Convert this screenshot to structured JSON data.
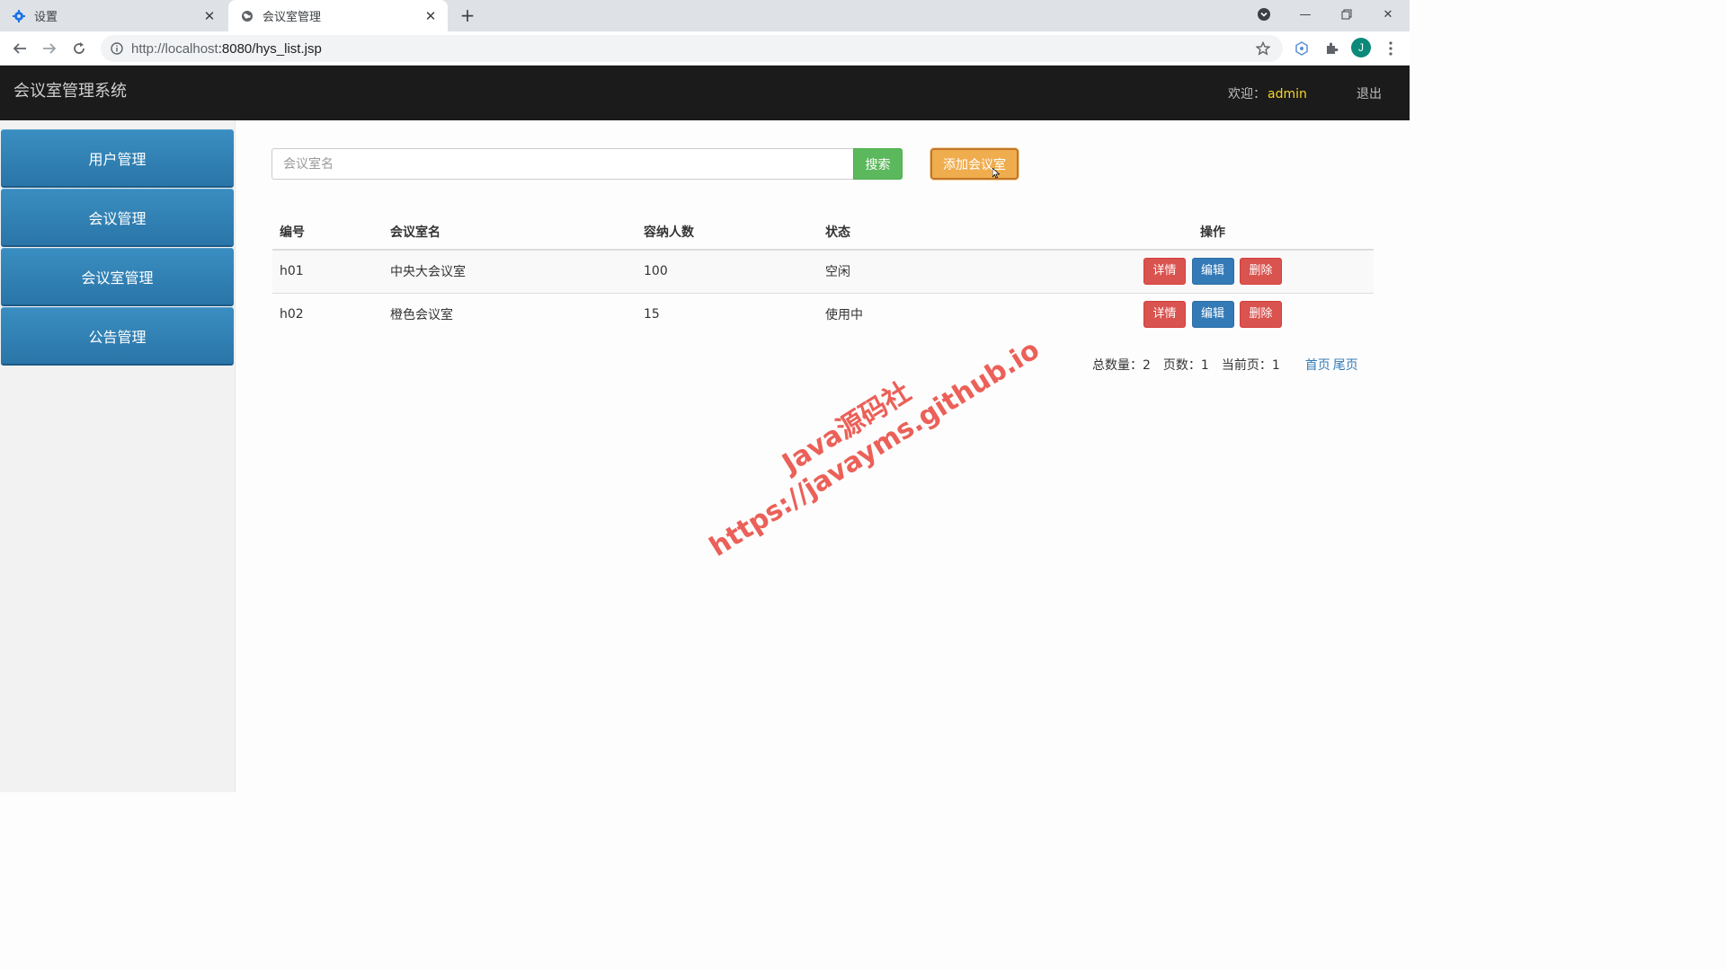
{
  "browser": {
    "tabs": [
      {
        "title": "设置",
        "icon": "gear-icon"
      },
      {
        "title": "会议室管理",
        "icon": "globe-icon"
      }
    ],
    "url_host": "http://localhost",
    "url_path": ":8080/hys_list.jsp",
    "profile_initial": "J"
  },
  "header": {
    "app_title": "会议室管理系统",
    "welcome_label": "欢迎：",
    "username": "admin",
    "logout_label": "退出"
  },
  "sidebar": {
    "items": [
      {
        "label": "用户管理"
      },
      {
        "label": "会议管理"
      },
      {
        "label": "会议室管理"
      },
      {
        "label": "公告管理"
      }
    ]
  },
  "search": {
    "placeholder": "会议室名",
    "button_label": "搜索",
    "add_label": "添加会议室"
  },
  "table": {
    "headers": {
      "id": "编号",
      "name": "会议室名",
      "capacity": "容纳人数",
      "status": "状态",
      "ops": "操作"
    },
    "rows": [
      {
        "id": "h01",
        "name": "中央大会议室",
        "capacity": "100",
        "status": "空闲"
      },
      {
        "id": "h02",
        "name": "橙色会议室",
        "capacity": "15",
        "status": "使用中"
      }
    ],
    "actions": {
      "detail": "详情",
      "edit": "编辑",
      "delete": "删除"
    }
  },
  "pager": {
    "total": "总数量：2",
    "pages": "页数：1",
    "current": "当前页：1",
    "first": "首页",
    "last": "尾页"
  },
  "watermark": {
    "line1": "Java源码社",
    "line2": "https://javayms.github.io"
  },
  "colors": {
    "header_bg": "#1b1b1b",
    "sidebar_item": "#2a75a8",
    "search_btn": "#5cb85c",
    "add_btn": "#f0ad4e",
    "danger": "#d9534f",
    "primary": "#337ab7",
    "username": "#f5d42a"
  }
}
